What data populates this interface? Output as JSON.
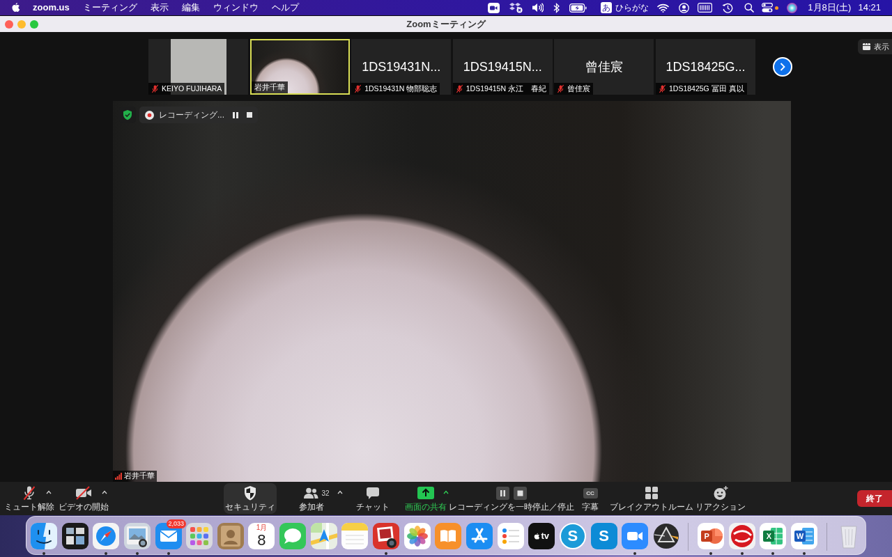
{
  "menu_bar": {
    "app_name": "zoom.us",
    "menus": [
      "ミーティング",
      "表示",
      "編集",
      "ウィンドウ",
      "ヘルプ"
    ],
    "input_mode": {
      "glyph": "あ",
      "label": "ひらがな"
    },
    "date": "1月8日(土)",
    "time": "14:21"
  },
  "window": {
    "title": "Zoomミーティング"
  },
  "view_button": {
    "label": "表示"
  },
  "gallery": {
    "tiles": [
      {
        "kind": "portrait",
        "caption": "KEIYO FUJIHARA",
        "muted": true,
        "selected": false
      },
      {
        "kind": "video",
        "caption": "岩井千華",
        "muted": false,
        "selected": true
      },
      {
        "kind": "name",
        "display_name": "1DS19431N...",
        "caption": "1DS19431N 物部聡志",
        "muted": true,
        "selected": false
      },
      {
        "kind": "name",
        "display_name": "1DS19415N...",
        "caption": "1DS19415N 永江　春紀",
        "muted": true,
        "selected": false
      },
      {
        "kind": "name",
        "display_name": "曾佳宸",
        "caption": "曾佳宸",
        "muted": true,
        "selected": false
      },
      {
        "kind": "name",
        "display_name": "1DS18425G...",
        "caption": "1DS18425G 冨田 真以",
        "muted": true,
        "selected": false
      }
    ]
  },
  "main_video": {
    "recording_label": "レコーディング...",
    "speaker": "岩井千華"
  },
  "toolbar": {
    "items": [
      {
        "kind": "mic",
        "label": "ミュート解除",
        "off": true,
        "caret": true,
        "highlighted": false
      },
      {
        "kind": "camera",
        "label": "ビデオの開始",
        "off": true,
        "caret": true,
        "highlighted": false
      },
      {
        "kind": "security",
        "label": "セキュリティ",
        "caret": false,
        "highlighted": true
      },
      {
        "kind": "participants",
        "label": "参加者",
        "count": "32",
        "caret": true,
        "highlighted": false
      },
      {
        "kind": "chat",
        "label": "チャット",
        "caret": false,
        "highlighted": false
      },
      {
        "kind": "share",
        "label": "画面の共有",
        "active": true,
        "caret": true,
        "highlighted": false
      },
      {
        "kind": "recording",
        "label": "レコーディングを一時停止／停止",
        "caret": false,
        "highlighted": false
      },
      {
        "kind": "captions",
        "label": "字幕",
        "glyph": "CC",
        "caret": false,
        "highlighted": false
      },
      {
        "kind": "breakout",
        "label": "ブレイクアウトルーム",
        "caret": false,
        "highlighted": false
      },
      {
        "kind": "reactions",
        "label": "リアクション",
        "caret": false,
        "highlighted": false
      }
    ],
    "end_button": "終了"
  },
  "dock": {
    "items": [
      {
        "kind": "finder",
        "running": true
      },
      {
        "kind": "mission_control",
        "running": false
      },
      {
        "kind": "safari",
        "running": true
      },
      {
        "kind": "preview",
        "running": true
      },
      {
        "kind": "mail",
        "running": true,
        "badge": "2,033"
      },
      {
        "kind": "launchpad",
        "running": false
      },
      {
        "kind": "contacts",
        "running": false
      },
      {
        "kind": "calendar",
        "running": false,
        "month": "1月",
        "day": "8"
      },
      {
        "kind": "messages",
        "running": false
      },
      {
        "kind": "maps",
        "running": false
      },
      {
        "kind": "notes",
        "running": false
      },
      {
        "kind": "photo_booth",
        "running": true
      },
      {
        "kind": "photos",
        "running": false
      },
      {
        "kind": "books",
        "running": false
      },
      {
        "kind": "app_store",
        "running": false
      },
      {
        "kind": "reminders",
        "running": false
      },
      {
        "kind": "tv",
        "running": false,
        "text": "tv"
      },
      {
        "kind": "skype_round",
        "running": false,
        "letter": "S"
      },
      {
        "kind": "skype_tile",
        "running": false,
        "letter": "S"
      },
      {
        "kind": "zoom",
        "running": true
      },
      {
        "kind": "prism",
        "running": false
      },
      {
        "kind": "divider"
      },
      {
        "kind": "powerpoint",
        "running": true,
        "letter": "P"
      },
      {
        "kind": "trend",
        "running": true
      },
      {
        "kind": "excel",
        "running": true,
        "letter": "X"
      },
      {
        "kind": "word",
        "running": true,
        "letter": "W"
      },
      {
        "kind": "divider"
      },
      {
        "kind": "trash",
        "running": false
      }
    ]
  }
}
